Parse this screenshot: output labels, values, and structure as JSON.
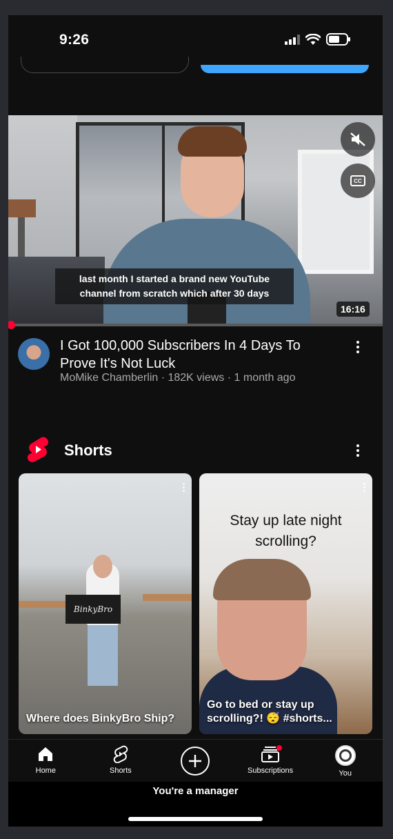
{
  "status_bar": {
    "time": "9:26"
  },
  "video": {
    "caption_line1": "last month I started a brand new YouTube",
    "caption_line2": "channel from scratch which after 30 days",
    "duration": "16:16",
    "progress": 0.01,
    "title": "I Got 100,000 Subscribers In 4 Days To Prove It's Not Luck",
    "meta": "MoMike Chamberlin · 182K views · 1 month ago",
    "icons": [
      "mute-icon",
      "closed-captions-icon",
      "more-vert-icon"
    ]
  },
  "shorts": {
    "section_title": "Shorts",
    "items": [
      {
        "title": "Where does BinkyBro Ship?",
        "sign_text": "BinkyBro"
      },
      {
        "overlay_text": "Stay up late night scrolling?",
        "title": "Go to bed or stay up scrolling?! 😴 #shorts..."
      }
    ]
  },
  "bottom_nav": [
    {
      "label": "Home",
      "icon": "home-icon"
    },
    {
      "label": "Shorts",
      "icon": "shorts-icon"
    },
    {
      "label": "",
      "icon": "create-icon"
    },
    {
      "label": "Subscriptions",
      "icon": "subscriptions-icon"
    },
    {
      "label": "You",
      "icon": "avatar-icon"
    }
  ],
  "footer": {
    "manager_text": "You're a manager"
  },
  "colors": {
    "accent_blue": "#3ea6ff",
    "brand_red": "#ff0033",
    "background": "#0f0f0f",
    "meta_gray": "#aaaaaa"
  }
}
